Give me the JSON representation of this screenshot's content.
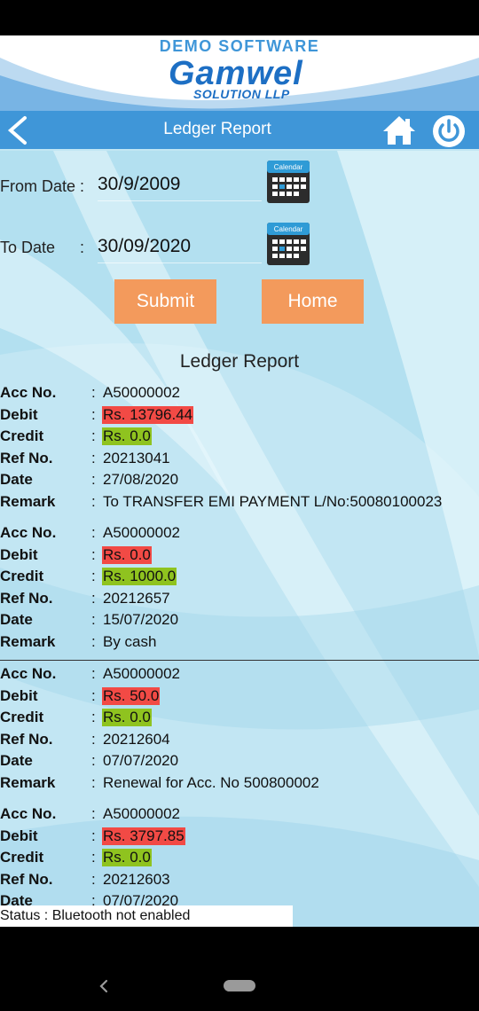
{
  "header": {
    "brand_top": "DEMO SOFTWARE",
    "brand_main": "Gamwel",
    "brand_sub": "SOLUTION LLP",
    "nav_title": "Ledger Report"
  },
  "form": {
    "from_label": "From Date :",
    "from_value": "30/9/2009",
    "to_label": "To Date",
    "to_colon": ":",
    "to_value": "30/09/2020",
    "calendar_text": "Calendar",
    "submit_label": "Submit",
    "home_label": "Home"
  },
  "report_title": "Ledger Report",
  "labels": {
    "acc": "Acc No.",
    "debit": "Debit",
    "credit": "Credit",
    "ref": "Ref No.",
    "date": "Date",
    "remark": "Remark",
    "colon": ":"
  },
  "entries": [
    {
      "acc": "A50000002",
      "debit": "Rs. 13796.44",
      "credit": "Rs. 0.0",
      "ref": "20213041",
      "date": "27/08/2020",
      "remark": "To TRANSFER EMI PAYMENT L/No:50080100023"
    },
    {
      "acc": "A50000002",
      "debit": "Rs. 0.0",
      "credit": "Rs. 1000.0",
      "ref": "20212657",
      "date": "15/07/2020",
      "remark": "By cash"
    },
    {
      "acc": "A50000002",
      "debit": "Rs. 50.0",
      "credit": "Rs. 0.0",
      "ref": "20212604",
      "date": "07/07/2020",
      "remark": "Renewal for Acc. No 500800002"
    },
    {
      "acc": "A50000002",
      "debit": "Rs. 3797.85",
      "credit": "Rs. 0.0",
      "ref": "20212603",
      "date": "07/07/2020",
      "remark": ""
    }
  ],
  "status": "Status : Bluetooth not enabled",
  "colors": {
    "nav_blue": "#3f96d8",
    "button_orange": "#f39a5c",
    "debit_red": "#f24a45",
    "credit_green": "#8fc31f"
  }
}
